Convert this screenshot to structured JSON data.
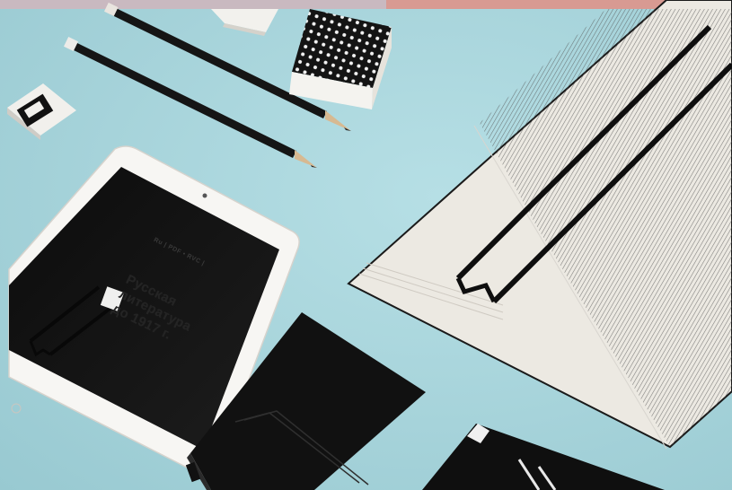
{
  "scene": {
    "background_color": "#a8d5dc",
    "paper_color": "#ece9e2",
    "ink_color": "#111111"
  },
  "tablet": {
    "tag": "Ru | PDF • RVC |",
    "title": "Русская\nлитература\nдо 1917 г."
  }
}
